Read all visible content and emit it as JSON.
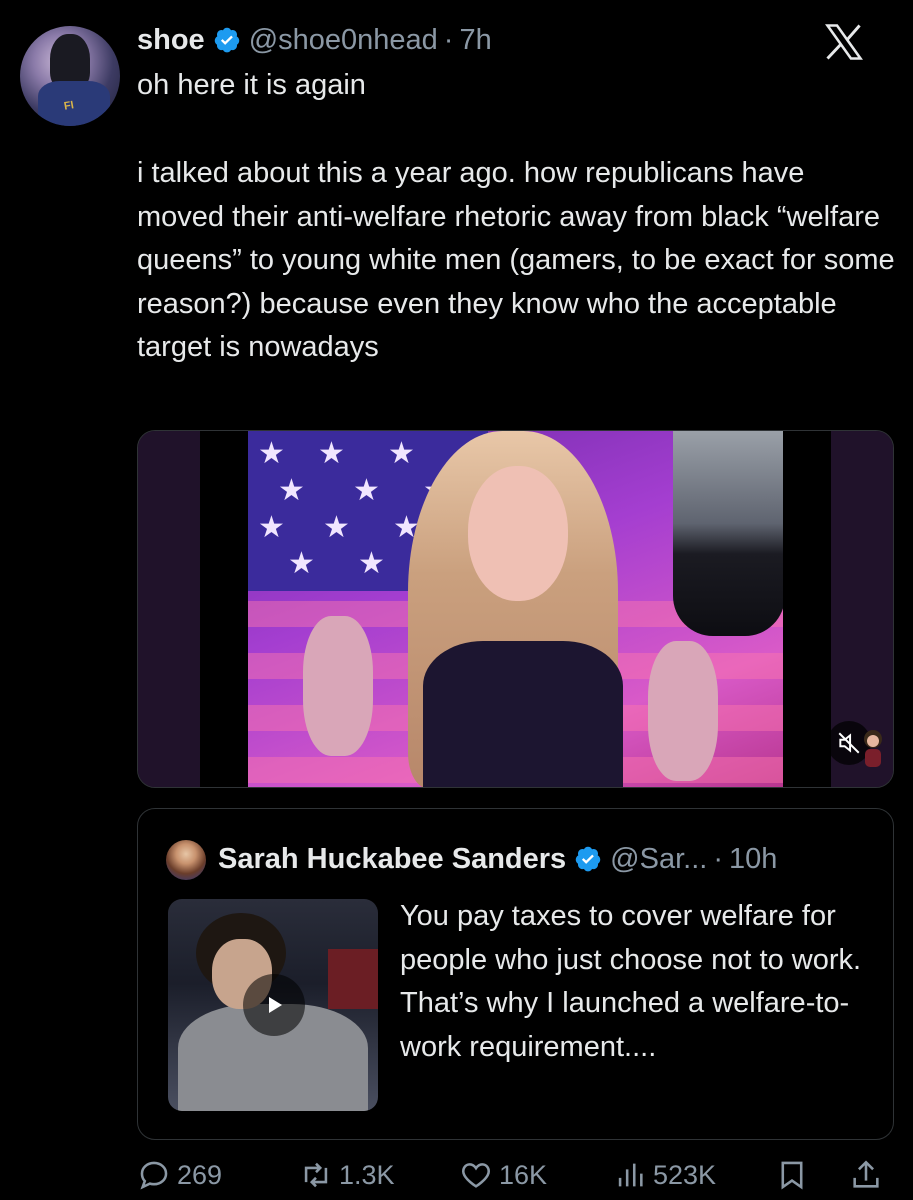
{
  "tweet": {
    "author_name": "shoe",
    "handle": "@shoe0nhead",
    "separator": "·",
    "time": "7h",
    "first_line": "oh here it is again",
    "body": "i talked about this a year ago. how republicans have moved their anti-welfare rhetoric away from black “welfare queens” to young white men (gamers, to be exact for some reason?) because even they know who the acceptable target is nowadays",
    "avatar_patch_text": "FI"
  },
  "quote": {
    "author_name": "Sarah Huckabee Sanders",
    "handle": "@Sar...",
    "separator": "·",
    "time": "10h",
    "text": "You pay taxes to cover welfare for people who just choose not to work. That’s why I launched a welfare-to-work requirement...."
  },
  "actions": {
    "replies": "269",
    "reposts": "1.3K",
    "likes": "16K",
    "views": "523K"
  },
  "icons": [
    "verified-badge-icon",
    "x-logo-icon",
    "mute-icon",
    "play-icon",
    "reply-icon",
    "repost-icon",
    "like-icon",
    "views-icon",
    "bookmark-icon",
    "share-icon"
  ],
  "colors": {
    "background": "#000000",
    "text": "#e7e9ea",
    "muted": "#8b98a5",
    "verified": "#1d9bf0",
    "border": "#2f3336"
  }
}
